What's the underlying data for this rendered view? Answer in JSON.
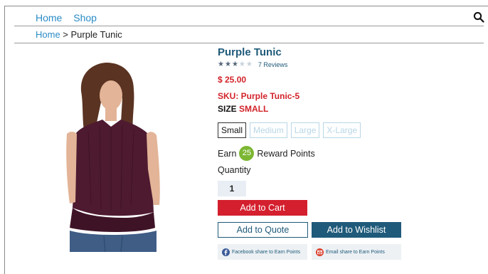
{
  "nav": {
    "home": "Home",
    "shop": "Shop"
  },
  "breadcrumb": {
    "home": "Home",
    "separator": " > ",
    "current": "Purple Tunic"
  },
  "product": {
    "title": "Purple Tunic",
    "rating": 3,
    "rating_max": 5,
    "reviews": "7 Reviews",
    "price": "$ 25.00",
    "sku": "SKU: Purple Tunic-5",
    "size_label": "SIZE",
    "size_value": "SMALL",
    "sizes": [
      "Small",
      "Medium",
      "Large",
      "X-Large"
    ],
    "selected_size": "Small",
    "earn_prefix": "Earn",
    "reward_points": "25",
    "earn_suffix": "Reward Points",
    "quantity_label": "Quantity",
    "quantity": "1"
  },
  "actions": {
    "add_to_cart": "Add to Cart",
    "add_to_quote": "Add to Quote",
    "add_to_wishlist": "Add to Wishlist",
    "facebook_share": "Facebook share to Earn Points",
    "email_share": "Email share to Earn Points"
  },
  "colors": {
    "link": "#2a8bc6",
    "title": "#1f5a7a",
    "price": "#d2232a",
    "cart_button": "#d41f2e",
    "wishlist_button": "#1f5a7a",
    "reward_badge": "#7cb733"
  },
  "icons": {
    "search": "search-icon",
    "facebook": "facebook-icon",
    "email": "email-icon"
  }
}
